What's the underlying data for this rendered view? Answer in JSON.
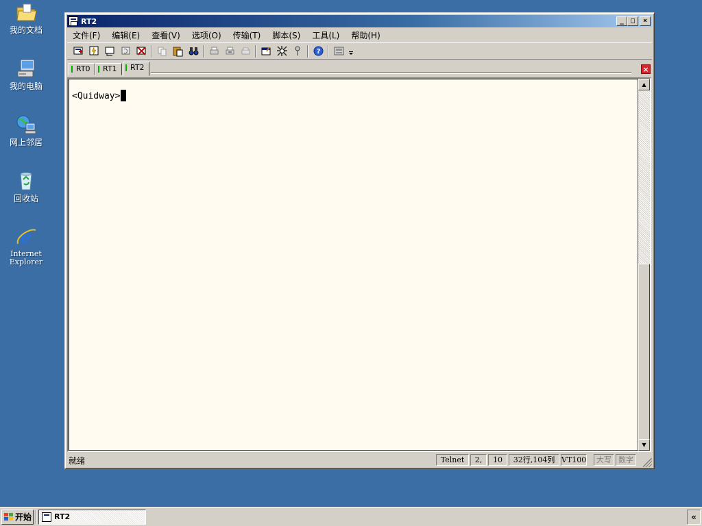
{
  "desktop": {
    "icons": [
      {
        "label": "我的文档"
      },
      {
        "label": "我的电脑"
      },
      {
        "label": "网上邻居"
      },
      {
        "label": "回收站"
      },
      {
        "label": "Internet Explorer"
      }
    ]
  },
  "window": {
    "title": "RT2",
    "buttons": {
      "minimize": "_",
      "maximize": "□",
      "close": "×"
    }
  },
  "menu": [
    {
      "label": "文件(F)"
    },
    {
      "label": "编辑(E)"
    },
    {
      "label": "查看(V)"
    },
    {
      "label": "选项(O)"
    },
    {
      "label": "传输(T)"
    },
    {
      "label": "脚本(S)"
    },
    {
      "label": "工具(L)"
    },
    {
      "label": "帮助(H)"
    }
  ],
  "tabs": [
    {
      "label": "RT0"
    },
    {
      "label": "RT1"
    },
    {
      "label": "RT2",
      "active": true
    }
  ],
  "terminal": {
    "prompt": "<Quidway>"
  },
  "status": {
    "ready": "就绪",
    "protocol": "Telnet",
    "row": "2,",
    "col": "10",
    "size": "32行,104列",
    "emulation": "VT100",
    "caps": "大写",
    "num": "数字"
  },
  "taskbar": {
    "start": "开始",
    "task": "RT2",
    "tray": "«"
  }
}
